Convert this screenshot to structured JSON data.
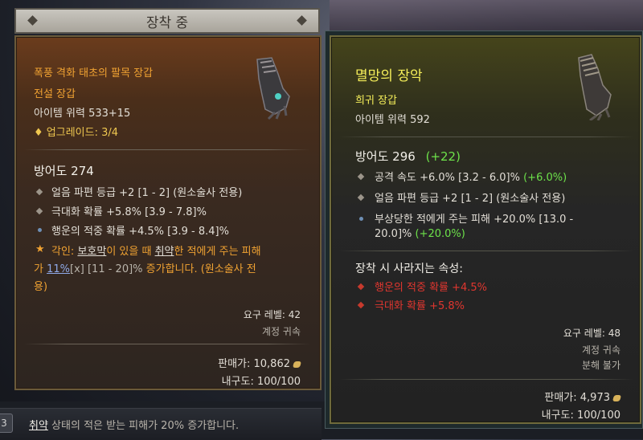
{
  "equipped_header": "장착 중",
  "left": {
    "item_name": "폭풍 격화 태초의 팔목 장갑",
    "item_type": "전설 장갑",
    "item_power": "아이템 위력 533+15",
    "upgrades": "업그레이드: 3/4",
    "armor": "방어도 274",
    "affixes": [
      "얼음 파편 등급 +2 [1 - 2] (원소술사 전용)",
      "극대화 확률 +5.8% [3.9 - 7.8]%",
      "행운의 적중 확률 +4.5% [3.9 - 8.4]%"
    ],
    "aspect": {
      "prefix": "각인: ",
      "barrier": "보호막",
      "mid1": "이 있을 때 ",
      "vulnerable": "취약",
      "mid2": "한 적에게 주는 피해",
      "line2_start": "가 ",
      "value": "11%",
      "x_mark": "[x]",
      "range": " [11 - 20]% ",
      "line2_end": "증가합니다. (원소술사 전",
      "line3": "용)"
    },
    "required_level": "요구 레벨: 42",
    "account_bound": "계정 귀속",
    "sell_value": "판매가: 10,862",
    "durability": "내구도: 100/100"
  },
  "right": {
    "item_name": "멸망의 장악",
    "item_type": "희귀 장갑",
    "item_power": "아이템 위력 592",
    "armor": "방어도 296",
    "armor_diff": "(+22)",
    "affixes": [
      {
        "text": "공격 속도 +6.0% [3.2 - 6.0]%",
        "diff": "(+6.0%)"
      },
      {
        "text": "얼음 파편 등급 +2 [1 - 2] (원소술사 전용)",
        "diff": ""
      },
      {
        "text": "부상당한 적에게 주는 피해 +20.0% [13.0 -",
        "line2": "20.0]%",
        "diff": "(+20.0%)"
      }
    ],
    "lost_header": "장착 시 사라지는 속성:",
    "lost": [
      "행운의 적중 확률 +4.5%",
      "극대화 확률 +5.8%"
    ],
    "required_level": "요구 레벨: 48",
    "account_bound": "계정 귀속",
    "no_salvage": "분해 불가",
    "sell_value": "판매가: 4,973",
    "durability": "내구도: 100/100"
  },
  "tooltip_bar": {
    "badge": "3",
    "keyword": "취약",
    "text": " 상태의 적은 받는 피해가 20% 증가합니다."
  },
  "colors": {
    "legendary": "#f0a232",
    "rare": "#f5ee5a",
    "improvement": "#6de24a",
    "lost": "#e0362f"
  }
}
